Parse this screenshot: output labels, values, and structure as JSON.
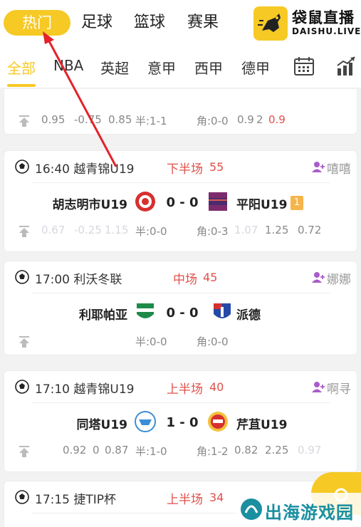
{
  "top_tabs": [
    "热门",
    "足球",
    "篮球",
    "赛果"
  ],
  "logo": {
    "cn": "袋鼠直播",
    "en": "DAISHU.LIVE"
  },
  "league_tabs": [
    "全部",
    "NBA",
    "英超",
    "意甲",
    "西甲",
    "德甲"
  ],
  "icons": {
    "calendar": "calendar-icon",
    "stats": "bar-chart-icon"
  },
  "colors": {
    "accent": "#f6c925",
    "live": "#e0504a",
    "arrow": "#e2232a",
    "watermark": "#1a8fa0"
  },
  "partial_match": {
    "odds": [
      "0.95",
      "-0.75",
      "0.85",
      "半:1-1",
      "角:0-0",
      "0.9",
      "2",
      "0.9"
    ]
  },
  "matches": [
    {
      "time_league": "16:40 越青锦U19",
      "status": "下半场",
      "minute": "55",
      "anchor": "嘻嘻",
      "home": "胡志明市U19",
      "away": "平阳U19",
      "score": "0 - 0",
      "card": "1",
      "odds": [
        "0.67",
        "-0.25",
        "1.15",
        "半:0-0",
        "角:0-3",
        "1.07",
        "1.25",
        "0.72"
      ]
    },
    {
      "time_league": "17:00 利沃冬联",
      "status": "中场",
      "minute": "45",
      "anchor": "娜娜",
      "home": "利耶帕亚",
      "away": "派德",
      "score": "0 - 0",
      "odds": [
        "半:0-0",
        "角:0-0"
      ]
    },
    {
      "time_league": "17:10 越青锦U19",
      "status": "上半场",
      "minute": "40",
      "anchor": "啊寻",
      "home": "同塔U19",
      "away": "芹苴U19",
      "score": "1 - 0",
      "odds": [
        "0.92",
        "0",
        "0.87",
        "半:1-0",
        "角:1-2",
        "0.82",
        "2.25",
        "0.97"
      ]
    },
    {
      "time_league": "17:15 捷TIP杯",
      "status": "上半场",
      "minute": "34"
    }
  ],
  "watermark": "出海游戏园"
}
